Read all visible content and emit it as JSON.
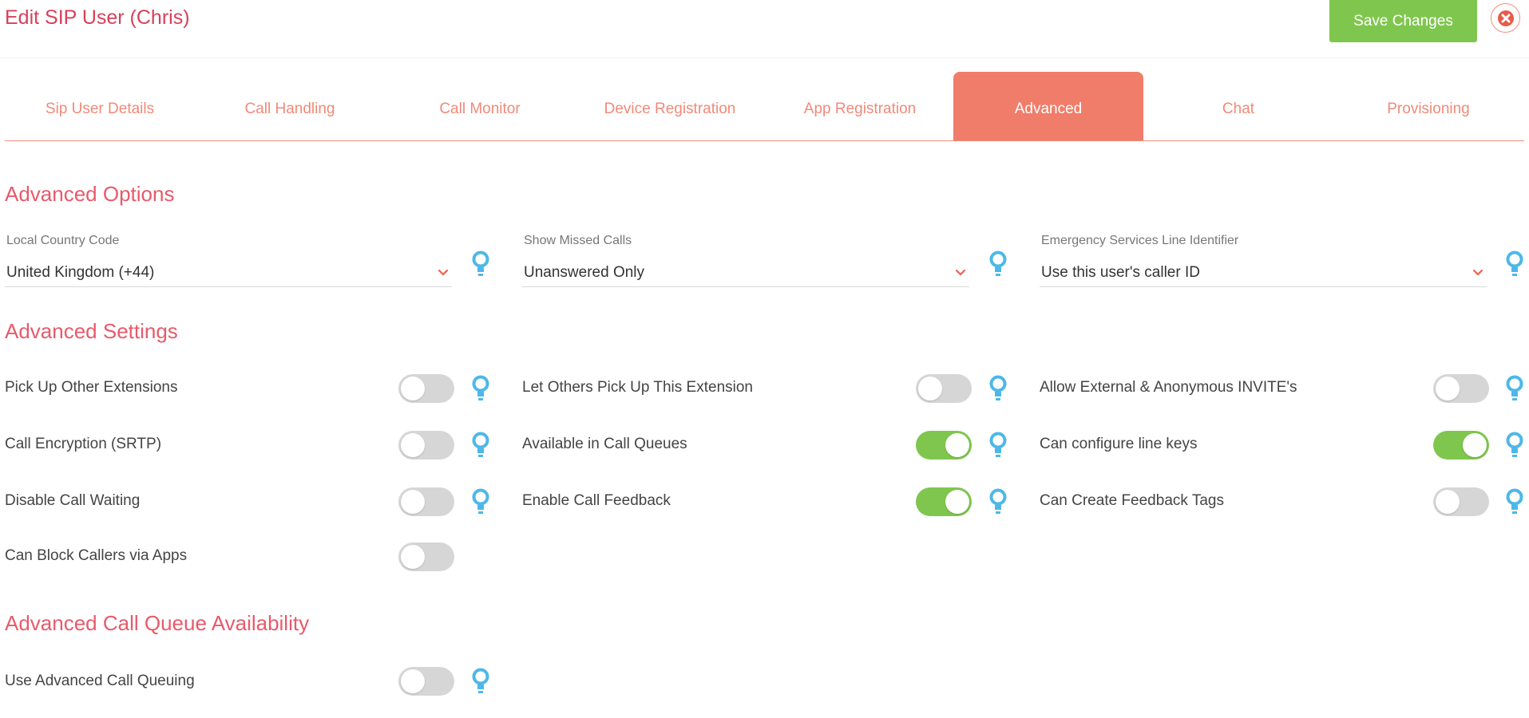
{
  "header": {
    "title": "Edit SIP User (Chris)",
    "save_label": "Save Changes"
  },
  "tabs": [
    {
      "label": "Sip User Details",
      "active": false
    },
    {
      "label": "Call Handling",
      "active": false
    },
    {
      "label": "Call Monitor",
      "active": false
    },
    {
      "label": "Device Registration",
      "active": false
    },
    {
      "label": "App Registration",
      "active": false
    },
    {
      "label": "Advanced",
      "active": true
    },
    {
      "label": "Chat",
      "active": false
    },
    {
      "label": "Provisioning",
      "active": false
    }
  ],
  "advanced_options": {
    "title": "Advanced Options",
    "fields": [
      {
        "label": "Local Country Code",
        "value": "United Kingdom (+44)"
      },
      {
        "label": "Show Missed Calls",
        "value": "Unanswered Only"
      },
      {
        "label": "Emergency Services Line Identifier",
        "value": "Use this user's caller ID"
      }
    ]
  },
  "advanced_settings": {
    "title": "Advanced Settings",
    "items": [
      {
        "label": "Pick Up Other Extensions",
        "on": false
      },
      {
        "label": "Let Others Pick Up This Extension",
        "on": false
      },
      {
        "label": "Allow External & Anonymous INVITE's",
        "on": false
      },
      {
        "label": "Call Encryption (SRTP)",
        "on": false
      },
      {
        "label": "Available in Call Queues",
        "on": true
      },
      {
        "label": "Can configure line keys",
        "on": true
      },
      {
        "label": "Disable Call Waiting",
        "on": false
      },
      {
        "label": "Enable Call Feedback",
        "on": true
      },
      {
        "label": "Can Create Feedback Tags",
        "on": false
      },
      {
        "label": "Can Block Callers via Apps",
        "on": false
      }
    ]
  },
  "call_queue": {
    "title": "Advanced Call Queue Availability",
    "items": [
      {
        "label": "Use Advanced Call Queuing",
        "on": false
      }
    ]
  },
  "colors": {
    "accent": "#e85a6a",
    "tab_active": "#f07c6a",
    "save_green": "#7fc64e",
    "bulb_blue": "#4db8e8"
  },
  "icons": {
    "close": "close-icon",
    "chevron": "chevron-down-icon",
    "help": "lightbulb-icon"
  }
}
